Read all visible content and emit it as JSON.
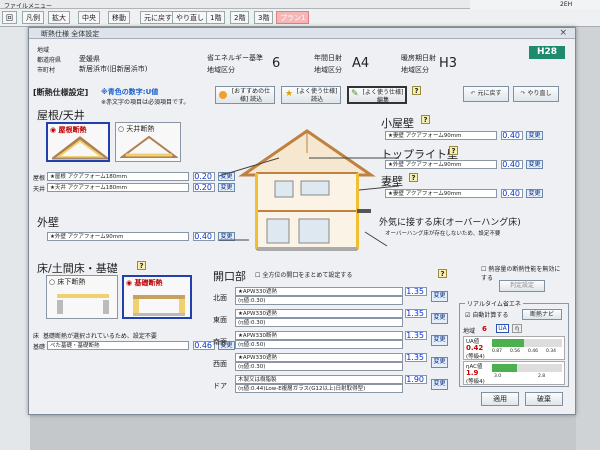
{
  "app": {
    "menu_items": [
      "ファイル",
      "メニュー"
    ],
    "toolbar": [
      "回",
      "凡例",
      "拡大",
      "中央",
      "移動",
      "元に戻す",
      "やり直し",
      "1階",
      "2階",
      "3階",
      "プラン1"
    ],
    "right_panel_text": "2EH"
  },
  "dialog": {
    "title": "断熱仕様 全体設定",
    "close": "×",
    "badge": "H28",
    "location": {
      "region_label": "地域",
      "region_value": "",
      "prefecture_label": "都道府県",
      "prefecture_value": "愛媛県",
      "city_label": "市町村",
      "city_value": "新居浜市(旧新居浜市)",
      "standard_label": "省エネルギー基準",
      "standard_region_label": "地域区分",
      "standard_region_value": "6",
      "annual_label": "年間日射",
      "annual_region_label": "地域区分",
      "annual_region_value": "A4",
      "heating_label": "暖房期日射",
      "heating_region_label": "地域区分",
      "heating_region_value": "H3"
    },
    "spec_settings": {
      "title": "[断熱仕様設定]",
      "note1": "※青色の数字:U値",
      "note2": "※赤文字の項目は必須項目です。",
      "btn_recommended": "[おすすめの仕様] 読込",
      "btn_favorite_load": "[よく使う仕様] 読込",
      "btn_favorite_save": "[よく使う仕様] 編集",
      "btn_undo": "元に戻す",
      "btn_redo": "やり直し"
    },
    "roof": {
      "title": "屋根/天井",
      "opt_roof": "屋根断熱",
      "opt_ceiling": "天井断熱",
      "rows": [
        {
          "label": "屋根",
          "spec": "★屋根 アクアフォーム180mm",
          "value": "0.20",
          "btn": "変更"
        },
        {
          "label": "天井",
          "spec": "★天井 アクアフォーム180mm",
          "value": "0.20",
          "btn": "変更"
        }
      ]
    },
    "wall": {
      "title": "外壁",
      "spec": "★外壁 アクアフォーム90mm",
      "value": "0.40",
      "btn": "変更"
    },
    "floor": {
      "title": "床/土間床・基礎",
      "opt_floor": "床下断熱",
      "opt_base": "基礎断熱",
      "row1_label": "床",
      "row1_text": "基礎断熱が選択されているため、設定不要",
      "row2_label": "基礎",
      "row2_spec": "べた基礎・基礎断熱",
      "value": "0.46",
      "btn": "変更"
    },
    "attic": {
      "title": "小屋壁",
      "spec": "★妻壁 アクアフォーム90mm",
      "value": "0.40",
      "btn": "変更"
    },
    "toplight": {
      "title": "トップライト壁",
      "spec": "★外壁 アクアフォーム90mm",
      "value": "0.40",
      "btn": "変更"
    },
    "gable": {
      "title": "妻壁",
      "spec": "★妻壁 アクアフォーム90mm",
      "value": "0.40",
      "btn": "変更"
    },
    "overhang": {
      "title": "外気に接する床(オーバーハング床)",
      "note": "オーバーハング床が存在しないため、設定不要"
    },
    "openings": {
      "title": "開口部",
      "all_check": "全方位の開口をまとめて設定する",
      "rows": [
        {
          "label": "北面",
          "spec": "★APW330遮熱",
          "sub": "(η値:0.30)",
          "value": "1.35",
          "btn": "変更"
        },
        {
          "label": "東面",
          "spec": "★APW330遮熱",
          "sub": "(η値:0.30)",
          "value": "1.35",
          "btn": "変更"
        },
        {
          "label": "南面",
          "spec": "★APW330断熱",
          "sub": "(η値:0.50)",
          "value": "1.35",
          "btn": "変更"
        },
        {
          "label": "西面",
          "spec": "★APW330遮熱",
          "sub": "(η値:0.30)",
          "value": "1.35",
          "btn": "変更"
        },
        {
          "label": "ドア",
          "spec": "木製又は樹脂製",
          "sub": "(η値:0.44)Low-E複層ガラス(G12以上)日射取得型)",
          "value": "1.90",
          "btn": "変更"
        }
      ]
    },
    "heat_storage": {
      "label": "熱容量の断熱性能を無効にする",
      "btn": "判定設定"
    },
    "realtime": {
      "title": "リアルタイム省エネ",
      "auto": "自動計算する",
      "btn_navi": "断熱ナビ",
      "region_label": "地域",
      "region_value": "6",
      "tab_ua": "UA",
      "tab_eta": "η",
      "ua_label": "UA値",
      "ua_value": "0.42",
      "ua_grade": "(等級4)",
      "ua_bar_fill": 0.45,
      "ua_scale": [
        "0.87",
        "0.56",
        "0.46",
        "0.34"
      ],
      "eta_label": "ηAC値",
      "eta_value": "1.9",
      "eta_grade": "(等級4)",
      "eta_bar_fill": 0.35,
      "eta_scale": [
        "3.0",
        "2.8"
      ]
    },
    "apply_btn": "適用",
    "cancel_btn": "破棄"
  }
}
